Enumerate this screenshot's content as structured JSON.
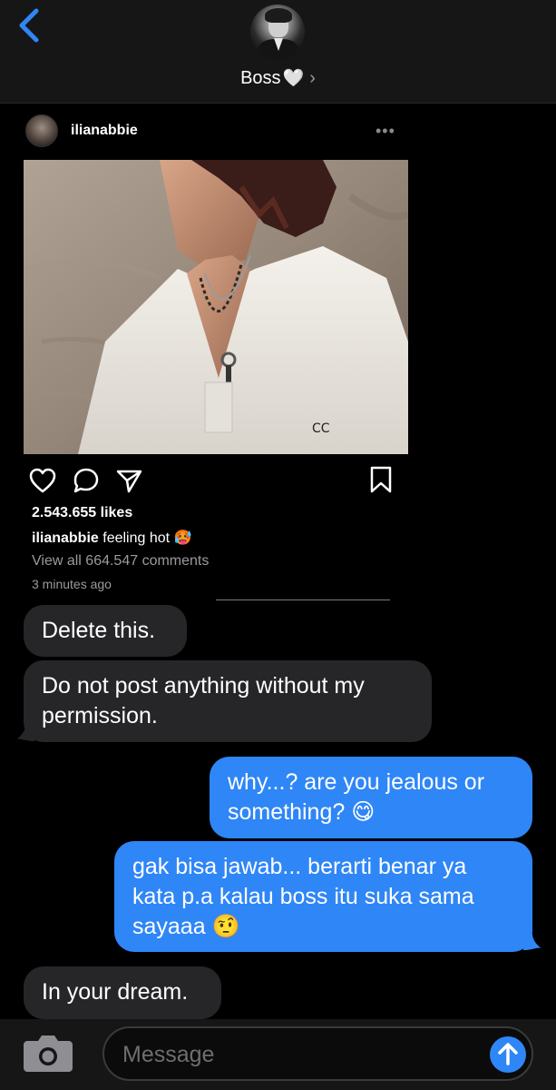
{
  "header": {
    "contact_name": "Boss",
    "contact_heart": "🤍",
    "chevron": "›"
  },
  "post": {
    "username": "ilianabbie",
    "more": "•••",
    "likes": "2.543.655 likes",
    "caption_user": "ilianabbie",
    "caption_text": " feeling hot 🥵",
    "view_comments": "View all 664.547 comments",
    "timestamp": "3 minutes ago"
  },
  "messages": [
    {
      "direction": "incoming",
      "lines": [
        "Delete this."
      ]
    },
    {
      "direction": "incoming",
      "lines": [
        "Do not post anything without my",
        "permission."
      ]
    },
    {
      "direction": "outgoing",
      "lines": [
        "why...? are you jealous or",
        "something? 😋"
      ]
    },
    {
      "direction": "outgoing",
      "lines": [
        "gak bisa jawab... berarti benar ya",
        "kata p.a kalau boss itu suka sama",
        "sayaaa 🤨"
      ]
    },
    {
      "direction": "incoming",
      "lines": [
        "In your dream."
      ]
    }
  ],
  "input": {
    "placeholder": "Message"
  },
  "icons": {
    "back": "chevron-left-icon",
    "camera": "camera-icon",
    "send": "arrow-up-icon",
    "like": "heart-icon",
    "comment": "comment-icon",
    "share": "send-icon",
    "save": "bookmark-icon"
  },
  "colors": {
    "accent_blue": "#2f86f6",
    "back_blue": "#2f86f6",
    "incoming_bubble": "#262628",
    "outgoing_bubble": "#2f86f6",
    "header_bg": "#161616"
  }
}
